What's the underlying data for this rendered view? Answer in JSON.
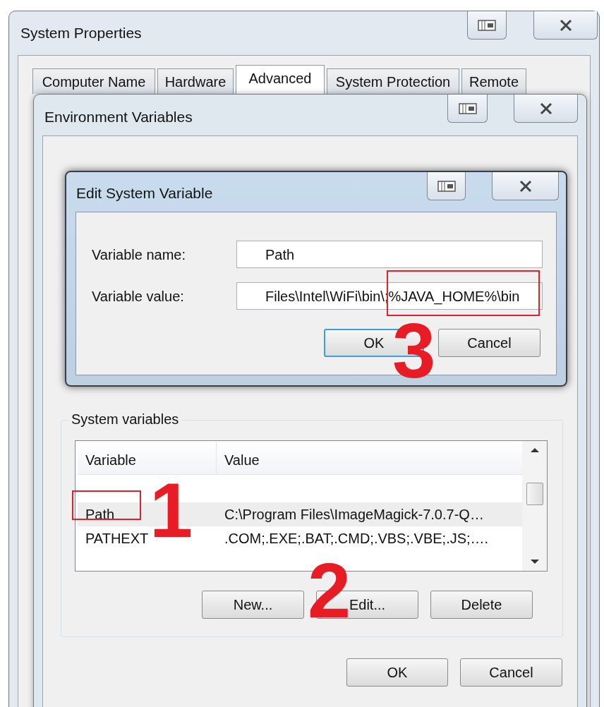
{
  "system_properties": {
    "title": "System Properties",
    "tabs": [
      {
        "label": "Computer Name",
        "selected": false
      },
      {
        "label": "Hardware",
        "selected": false
      },
      {
        "label": "Advanced",
        "selected": true
      },
      {
        "label": "System Protection",
        "selected": false
      },
      {
        "label": "Remote",
        "selected": false
      }
    ]
  },
  "environment_variables": {
    "title": "Environment Variables",
    "system_variables": {
      "label": "System variables",
      "columns": [
        "Variable",
        "Value"
      ],
      "rows": [
        {
          "variable": "Path",
          "value": "C:\\Program Files\\ImageMagick-7.0.7-Q…",
          "selected": true
        },
        {
          "variable": "PATHEXT",
          "value": ".COM;.EXE;.BAT;.CMD;.VBS;.VBE;.JS;….",
          "selected": false
        }
      ],
      "buttons": [
        "New...",
        "Edit...",
        "Delete"
      ]
    },
    "buttons": [
      "OK",
      "Cancel"
    ]
  },
  "edit_dialog": {
    "title": "Edit System Variable",
    "fields": [
      {
        "label": "Variable name:",
        "value": "Path"
      },
      {
        "label": "Variable value:",
        "value": "Files\\Intel\\WiFi\\bin\\;%JAVA_HOME%\\bin"
      }
    ],
    "buttons": [
      {
        "label": "OK",
        "default": true
      },
      {
        "label": "Cancel",
        "default": false
      }
    ]
  },
  "annotations": [
    {
      "kind": "box"
    },
    {
      "kind": "number",
      "text": "1"
    },
    {
      "kind": "number",
      "text": "2"
    },
    {
      "kind": "box"
    },
    {
      "kind": "number",
      "text": "3"
    }
  ]
}
